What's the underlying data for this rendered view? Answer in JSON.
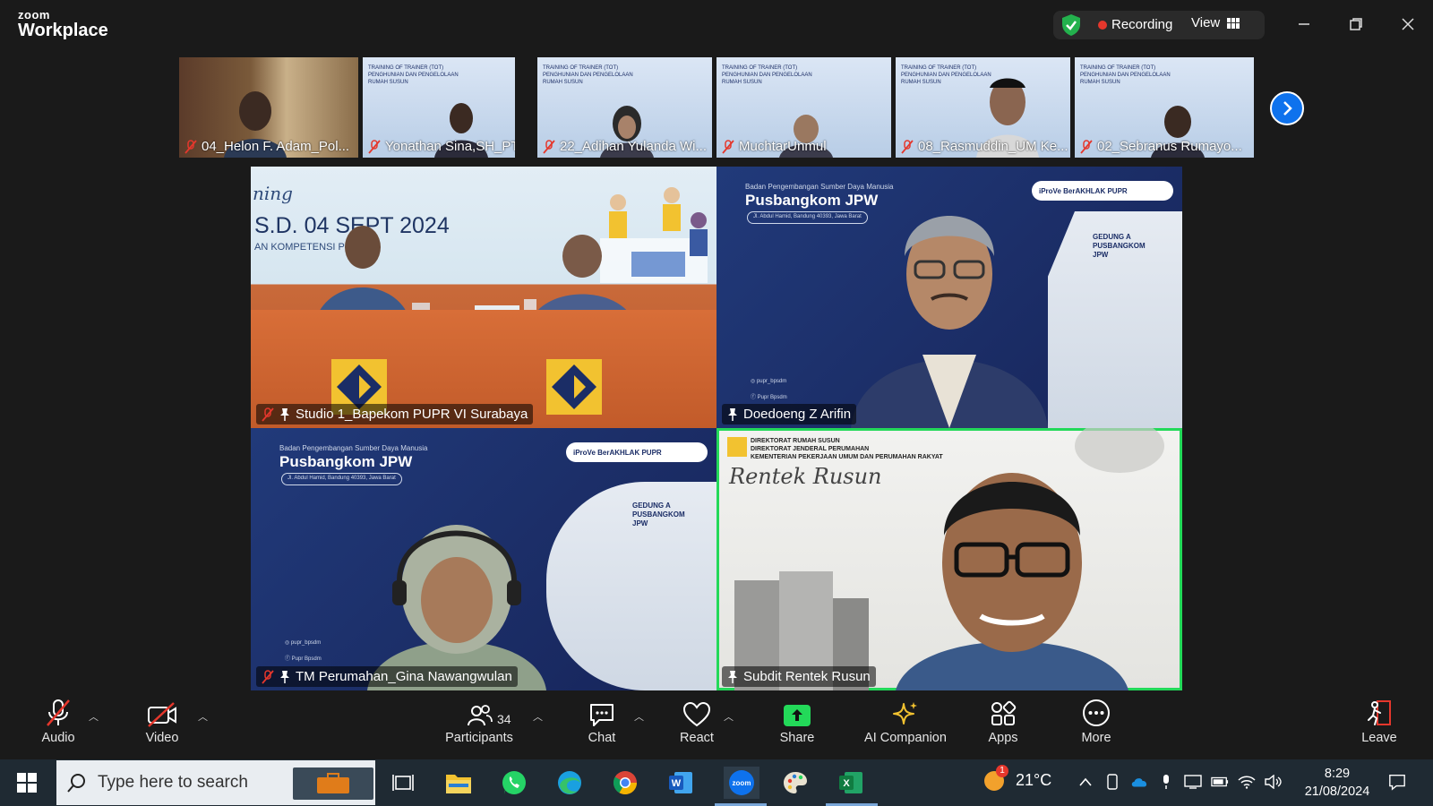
{
  "app": {
    "logo_small": "zoom",
    "logo_big": "Workplace"
  },
  "status": {
    "recording_label": "Recording",
    "view_label": "View"
  },
  "thumbnails": [
    {
      "name": "04_Helon  F. Adam_Pol..."
    },
    {
      "name": "Yonathan Sina,SH_PTS...."
    },
    {
      "name": "22_Adihan Yulanda Wi..."
    },
    {
      "name": "MuchtarUnmul"
    },
    {
      "name": "08_Rasmuddin_UM Ke..."
    },
    {
      "name": "02_Sebranus Rumayo..."
    }
  ],
  "tiles": {
    "studio": {
      "name": "Studio 1_Bapekom PUPR VI Surabaya",
      "banner_script": "ning",
      "banner_date": "S.D. 04 SEPT 2024",
      "banner_sub": "AN KOMPETENSI PU"
    },
    "doedoeng": {
      "name": "Doedoeng Z Arifin",
      "banner_small": "Badan Pengembangan Sumber Daya Manusia",
      "banner_big": "Pusbangkom JPW",
      "banner_chip": "Jl. Abdul Hamid, Bandung 40393, Jawa Barat",
      "logos": "iProVe  BerAKHLAK  PUPR",
      "social_ig": "pupr_bpsdm",
      "social_fb": "Pupr Bpsdm",
      "building": "GEDUNG A PUSBANGKOM JPW"
    },
    "gina": {
      "name": "TM Perumahan_Gina Nawangwulan",
      "banner_small": "Badan Pengembangan Sumber Daya Manusia",
      "banner_big": "Pusbangkom JPW",
      "banner_chip": "Jl. Abdul Hamid, Bandung 40393, Jawa Barat",
      "logos": "iProVe  BerAKHLAK  PUPR",
      "social_ig": "pupr_bpsdm",
      "social_fb": "Pupr Bpsdm",
      "building": "GEDUNG A PUSBANGKOM JPW"
    },
    "rentek": {
      "name": "Subdit Rentek Rusun",
      "header_line1": "DIREKTORAT RUMAH SUSUN",
      "header_line2": "DIREKTORAT JENDERAL PERUMAHAN",
      "header_line3": "KEMENTERIAN PEKERJAAN UMUM DAN PERUMAHAN RAKYAT",
      "script": "Rentek Rusun"
    }
  },
  "toolbar": {
    "audio": "Audio",
    "video": "Video",
    "participants": "Participants",
    "participants_count": "34",
    "chat": "Chat",
    "react": "React",
    "share": "Share",
    "ai_companion": "AI Companion",
    "apps": "Apps",
    "more": "More",
    "leave": "Leave"
  },
  "taskbar": {
    "search_placeholder": "Type here to search",
    "weather_temp": "21°C",
    "weather_badge": "1",
    "time": "8:29",
    "date": "21/08/2024"
  },
  "colors": {
    "accent_blue": "#0e72ed",
    "recording_red": "#e5372c",
    "active_speaker_green": "#23d959",
    "share_green": "#23d959",
    "banner_navy": "#1b2d66"
  }
}
